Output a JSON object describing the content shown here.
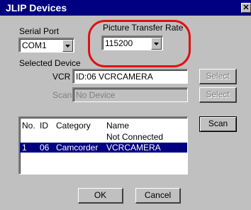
{
  "window": {
    "title": "JLIP Devices",
    "close_glyph": "✕"
  },
  "serial_port": {
    "label": "Serial Port",
    "value": "COM1"
  },
  "transfer_rate": {
    "label": "Picture Transfer Rate",
    "value": "115200"
  },
  "selected_device": {
    "label": "Selected Device",
    "vcr": {
      "label": "VCR",
      "value": "ID:06 VCRCAMERA",
      "button": "Select"
    },
    "scan": {
      "label": "Scan",
      "value": "No Device",
      "button": "Select"
    }
  },
  "device_list": {
    "columns": [
      "No.",
      "ID",
      "Category",
      "Name"
    ],
    "rows": [
      {
        "no": "",
        "id": "",
        "category": "",
        "name": "Not Connected",
        "selected": false
      },
      {
        "no": "1",
        "id": "06",
        "category": "Camcorder",
        "name": "VCRCAMERA",
        "selected": true
      }
    ],
    "scan_button": "Scan"
  },
  "buttons": {
    "ok": "OK",
    "cancel": "Cancel"
  },
  "annotation": {
    "color": "#e01010"
  },
  "colors": {
    "title_bar": "#000080",
    "selection": "#000080",
    "face": "#c0c0c0"
  }
}
